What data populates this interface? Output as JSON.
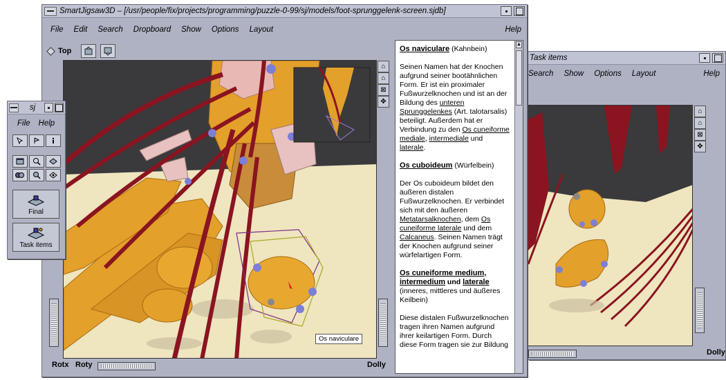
{
  "main_window": {
    "title": "SmartJigsaw3D – [/usr/people/fix/projects/programming/puzzle-0-99/sj/models/foot-sprunggelenk-screen.sjdb]",
    "menu": [
      "File",
      "Edit",
      "Search",
      "Dropboard",
      "Show",
      "Options",
      "Layout"
    ],
    "help": "Help",
    "toolbar": {
      "view_label": "Top"
    },
    "viewer": {
      "selection_label": "Os naviculare",
      "rotx_label": "Rotx",
      "roty_label": "Roty",
      "dolly_label": "Dolly"
    },
    "text_panel": [
      {
        "heading": "Os naviculare",
        "suffix": " (Kahnbein)"
      },
      {
        "p1": "Seinen Namen hat der Knochen aufgrund seiner bootähnlichen Form. Er ist ein proximaler Fußwurzelknochen und ist an der Bildung des ",
        "link1": "unteren Sprunggelenkes",
        "p1b": " (Art. talotarsalis) beteiligt. Außerdem hat er Verbindung zu den ",
        "link2": "Os cuneiforme mediale",
        "p1c": ", ",
        "link3": "intermediale",
        "p1d": " und ",
        "link4": "laterale",
        "p1e": "."
      },
      {
        "heading": "Os cuboideum",
        "suffix": " (Würfelbein)"
      },
      {
        "p1": "Der Os cuboideum bildet den äußeren distalen Fußwurzelknochen. Er verbindet sich mit den äußeren ",
        "link1": "Metatarsalknochen",
        "p1b": ", dem ",
        "link2": "Os cuneiforme laterale",
        "p1c": " und dem ",
        "link3": "Calcaneus",
        "p1d": ". Seinen Namen trägt der Knochen aufgrund seiner würfelartigen Form."
      },
      {
        "h1": "Os cuneiforme medium,",
        "h2": "intermedium",
        "und": " und ",
        "h3": "laterale",
        "rest": " (inneres, mittleres und äußeres Keilbein)"
      },
      {
        "p1": "Diese distalen Fußwurzelknochen tragen ihren Namen aufgrund ihrer keilartigen Form. Durch diese Form tragen sie zur Bildung"
      }
    ]
  },
  "palette_window": {
    "title": "sj",
    "menu": [
      "File",
      "Help"
    ],
    "final_label": "Final",
    "task_items_label": "Task items"
  },
  "task_window": {
    "title": "Task items",
    "menu": [
      "Search",
      "Show",
      "Options",
      "Layout"
    ],
    "help": "Help",
    "dolly_label": "Dolly"
  },
  "colors": {
    "window_bg": "#aeb2c3",
    "floor": "#efe5bf",
    "sky": "#3a3a3c",
    "bone": "#e3a02a",
    "muscle": "#8a1420",
    "joint_node": "#7d7fd6"
  }
}
